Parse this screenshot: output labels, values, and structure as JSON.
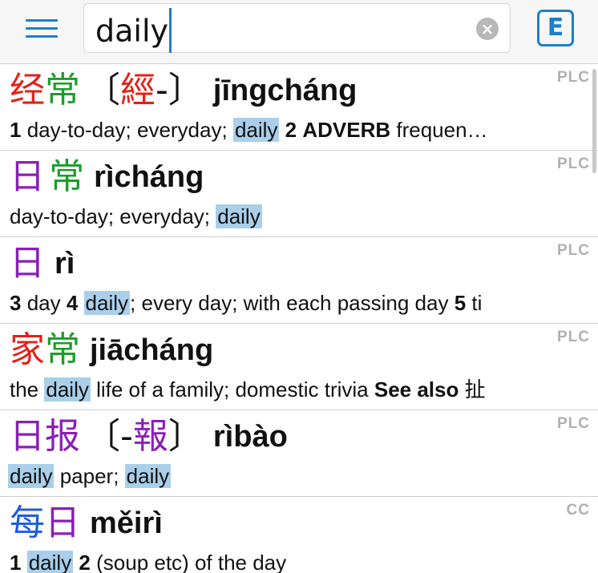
{
  "search": {
    "query": "daily"
  },
  "buttons": {
    "clear_symbol": "×",
    "lang_toggle": "E"
  },
  "entries": [
    {
      "source": "PLC",
      "simp": [
        "经",
        "常"
      ],
      "trad": "〔經-〕",
      "pinyin": "jīngcháng",
      "def": {
        "n1": "1",
        "t1": " day-to-day; everyday; ",
        "h1": "daily",
        "n2": "2",
        "b1": "ADVERB",
        "t2": " frequen…"
      }
    },
    {
      "source": "PLC",
      "simp": [
        "日",
        "常"
      ],
      "pinyin": "rìcháng",
      "def": {
        "t1": "day-to-day; everyday; ",
        "h1": "daily"
      }
    },
    {
      "source": "PLC",
      "simp": [
        "日"
      ],
      "pinyin": "rì",
      "def": {
        "n1": "3",
        "t1": " day  ",
        "n2": "4",
        "h1": "daily",
        "t2": "; every day; with each passing day  ",
        "n3": "5",
        "t3": " ti"
      }
    },
    {
      "source": "PLC",
      "simp": [
        "家",
        "常"
      ],
      "pinyin": "jiācháng",
      "def": {
        "t1": "the ",
        "h1": "daily",
        "t2": " life of a family; domestic trivia ",
        "b1": "See also",
        "t3": " 扯"
      }
    },
    {
      "source": "PLC",
      "simp": [
        "日",
        "报"
      ],
      "trad": "〔-報〕",
      "pinyin": "rìbào",
      "def": {
        "h1": "daily",
        "t1": " paper; ",
        "h2": "daily"
      }
    },
    {
      "source": "CC",
      "simp": [
        "每",
        "日"
      ],
      "pinyin": "měirì",
      "def": {
        "n1": "1",
        "h1": "daily",
        "n2": "2",
        "t1": " (soup etc) of the day"
      }
    }
  ],
  "colors": {
    "accent": "#1f7fc8",
    "highlight": "#a9cfea",
    "tone1": "#e32119",
    "tone2": "#1b9d2a",
    "tone3": "#1f5fd6",
    "tone4": "#8a1fb8"
  }
}
